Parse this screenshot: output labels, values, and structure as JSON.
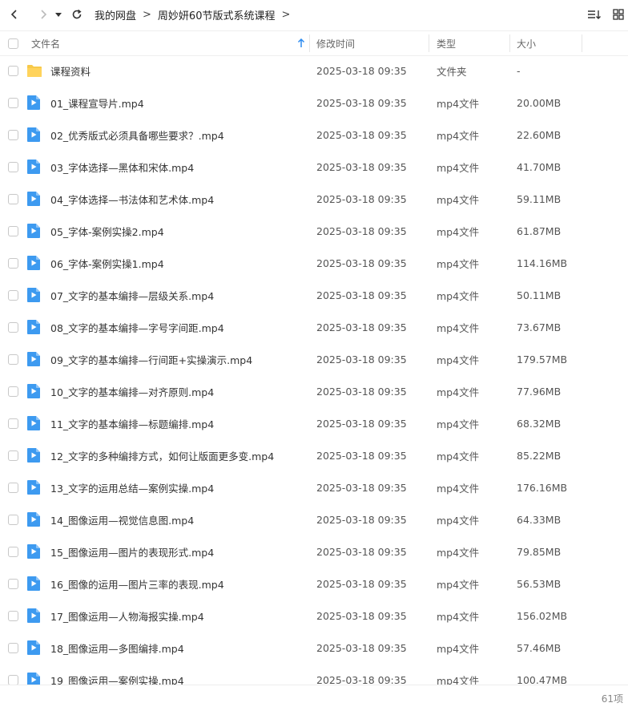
{
  "breadcrumb": [
    "我的网盘",
    "周妙妍60节版式系统课程"
  ],
  "columns": {
    "name": "文件名",
    "modified": "修改时间",
    "type": "类型",
    "size": "大小"
  },
  "colors": {
    "folder": "#f7c94a",
    "video": "#3d9af0",
    "sort_arrow": "#2d8cf0"
  },
  "files": [
    {
      "icon": "folder-icon",
      "name": "课程资料",
      "modified": "2025-03-18 09:35",
      "type": "文件夹",
      "size": "-"
    },
    {
      "icon": "video-file-icon",
      "name": "01_课程宣导片.mp4",
      "modified": "2025-03-18 09:35",
      "type": "mp4文件",
      "size": "20.00MB"
    },
    {
      "icon": "video-file-icon",
      "name": "02_优秀版式必须具备哪些要求？.mp4",
      "modified": "2025-03-18 09:35",
      "type": "mp4文件",
      "size": "22.60MB"
    },
    {
      "icon": "video-file-icon",
      "name": "03_字体选择—黑体和宋体.mp4",
      "modified": "2025-03-18 09:35",
      "type": "mp4文件",
      "size": "41.70MB"
    },
    {
      "icon": "video-file-icon",
      "name": "04_字体选择—书法体和艺术体.mp4",
      "modified": "2025-03-18 09:35",
      "type": "mp4文件",
      "size": "59.11MB"
    },
    {
      "icon": "video-file-icon",
      "name": "05_字体-案例实操2.mp4",
      "modified": "2025-03-18 09:35",
      "type": "mp4文件",
      "size": "61.87MB"
    },
    {
      "icon": "video-file-icon",
      "name": "06_字体-案例实操1.mp4",
      "modified": "2025-03-18 09:35",
      "type": "mp4文件",
      "size": "114.16MB"
    },
    {
      "icon": "video-file-icon",
      "name": "07_文字的基本编排—层级关系.mp4",
      "modified": "2025-03-18 09:35",
      "type": "mp4文件",
      "size": "50.11MB"
    },
    {
      "icon": "video-file-icon",
      "name": "08_文字的基本编排—字号字间距.mp4",
      "modified": "2025-03-18 09:35",
      "type": "mp4文件",
      "size": "73.67MB"
    },
    {
      "icon": "video-file-icon",
      "name": "09_文字的基本编排—行间距+实操演示.mp4",
      "modified": "2025-03-18 09:35",
      "type": "mp4文件",
      "size": "179.57MB"
    },
    {
      "icon": "video-file-icon",
      "name": "10_文字的基本编排—对齐原则.mp4",
      "modified": "2025-03-18 09:35",
      "type": "mp4文件",
      "size": "77.96MB"
    },
    {
      "icon": "video-file-icon",
      "name": "11_文字的基本编排—标题编排.mp4",
      "modified": "2025-03-18 09:35",
      "type": "mp4文件",
      "size": "68.32MB"
    },
    {
      "icon": "video-file-icon",
      "name": "12_文字的多种编排方式，如何让版面更多变.mp4",
      "modified": "2025-03-18 09:35",
      "type": "mp4文件",
      "size": "85.22MB"
    },
    {
      "icon": "video-file-icon",
      "name": "13_文字的运用总结—案例实操.mp4",
      "modified": "2025-03-18 09:35",
      "type": "mp4文件",
      "size": "176.16MB"
    },
    {
      "icon": "video-file-icon",
      "name": "14_图像运用—视觉信息图.mp4",
      "modified": "2025-03-18 09:35",
      "type": "mp4文件",
      "size": "64.33MB"
    },
    {
      "icon": "video-file-icon",
      "name": "15_图像运用—图片的表现形式.mp4",
      "modified": "2025-03-18 09:35",
      "type": "mp4文件",
      "size": "79.85MB"
    },
    {
      "icon": "video-file-icon",
      "name": "16_图像的运用—图片三率的表现.mp4",
      "modified": "2025-03-18 09:35",
      "type": "mp4文件",
      "size": "56.53MB"
    },
    {
      "icon": "video-file-icon",
      "name": "17_图像运用—人物海报实操.mp4",
      "modified": "2025-03-18 09:35",
      "type": "mp4文件",
      "size": "156.02MB"
    },
    {
      "icon": "video-file-icon",
      "name": "18_图像运用—多图编排.mp4",
      "modified": "2025-03-18 09:35",
      "type": "mp4文件",
      "size": "57.46MB"
    },
    {
      "icon": "video-file-icon",
      "name": "19_图像运用—案例实操.mp4",
      "modified": "2025-03-18 09:35",
      "type": "mp4文件",
      "size": "100.47MB"
    }
  ],
  "status": {
    "item_count": "61项"
  }
}
